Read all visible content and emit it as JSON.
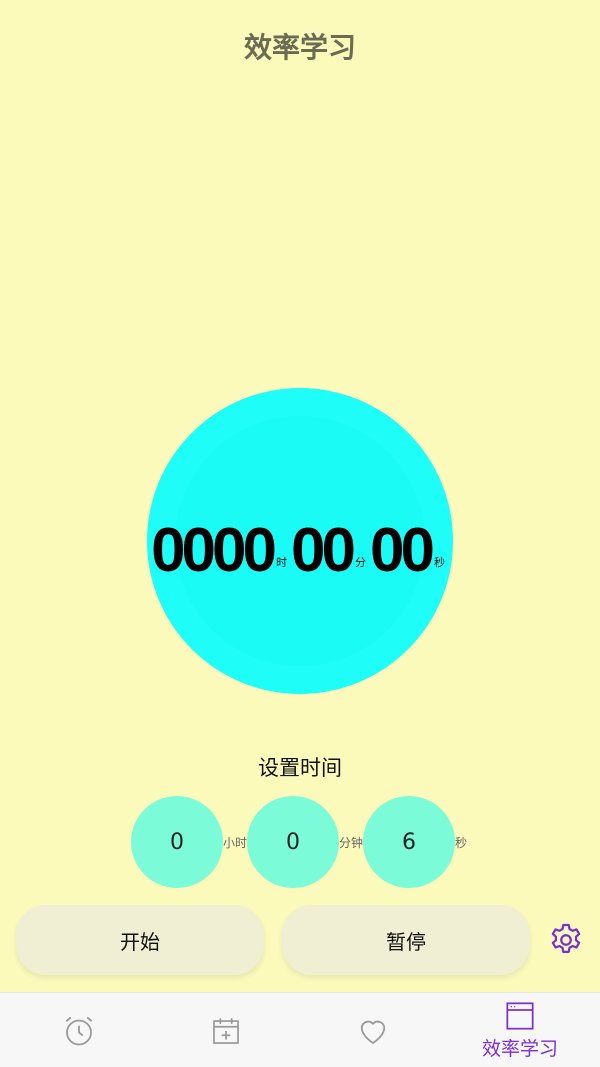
{
  "header": {
    "title": "效率学习"
  },
  "timer": {
    "hours": "0000",
    "hours_unit": "时",
    "minutes": "00",
    "minutes_unit": "分",
    "seconds": "00",
    "seconds_unit": "秒"
  },
  "settings": {
    "label": "设置时间",
    "hours_value": "0",
    "hours_unit": "小时",
    "minutes_value": "0",
    "minutes_unit": "分钟",
    "seconds_value": "6",
    "seconds_unit": "秒"
  },
  "actions": {
    "start": "开始",
    "pause": "暂停"
  },
  "tabbar": {
    "tabs": [
      {
        "icon": "alarm-clock-icon"
      },
      {
        "icon": "calendar-add-icon"
      },
      {
        "icon": "heart-icon"
      },
      {
        "icon": "window-icon",
        "label": "效率学习",
        "active": true
      }
    ]
  },
  "colors": {
    "background": "#fbfabb",
    "circle": "#1ffdf8",
    "bubble": "#7cfbd9",
    "button": "#f0eed3",
    "accent": "#7b2ed6"
  }
}
